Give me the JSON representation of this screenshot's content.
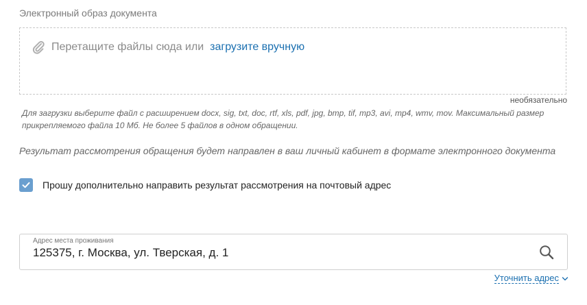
{
  "attachment": {
    "label": "Электронный образ документа",
    "drop_text": "Перетащите файлы сюда или",
    "upload_link": "загрузите вручную",
    "optional": "необязательно",
    "hint": "Для загрузки выберите файл с расширением docx, sig, txt, doc, rtf, xls, pdf, jpg, bmp, tif, mp3, avi, mp4, wmv, mov. Максимальный размер прикрепляемого файла 10 Мб. Не более 5 файлов в одном обращении.",
    "icon": "paperclip-icon"
  },
  "result_note": "Результат рассмотрения обращения будет направлен в ваш личный кабинет в формате электронного документа",
  "postal_checkbox": {
    "checked": true,
    "label": "Прошу дополнительно направить результат рассмотрения на почтовый адрес"
  },
  "address": {
    "label": "Адрес места проживания",
    "value": "125375, г. Москва, ул. Тверская, д. 1",
    "search_icon": "search-icon",
    "refine_label": "Уточнить адрес"
  },
  "colors": {
    "link": "#1a6fb0",
    "checkbox": "#6a9fcf"
  }
}
